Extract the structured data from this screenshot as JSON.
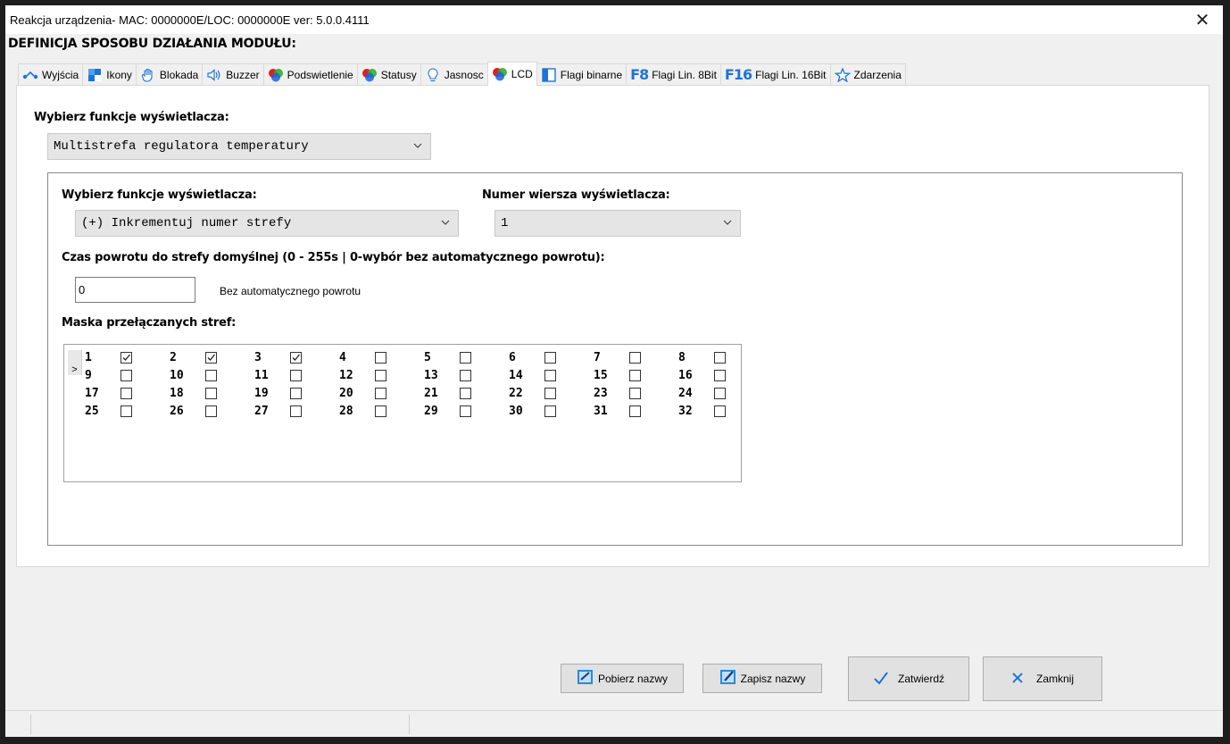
{
  "window": {
    "title": "Reakcja urządzenia- MAC: 0000000E/LOC: 0000000E ver: 5.0.0.4111",
    "close_glyph": "✕"
  },
  "header": {
    "title": "DEFINICJA SPOSOBU DZIAŁANIA MODUŁU:"
  },
  "tabs": [
    {
      "label": "Wyjścia",
      "icon": "outputs-icon"
    },
    {
      "label": "Ikony",
      "icon": "icons-icon"
    },
    {
      "label": "Blokada",
      "icon": "hand-icon"
    },
    {
      "label": "Buzzer",
      "icon": "speaker-icon"
    },
    {
      "label": "Podswietlenie",
      "icon": "rgb-icon"
    },
    {
      "label": "Statusy",
      "icon": "rgb-icon"
    },
    {
      "label": "Jasnosc",
      "icon": "bulb-icon"
    },
    {
      "label": "LCD",
      "icon": "rgb-icon",
      "active": true
    },
    {
      "label": "Flagi binarne",
      "icon": "binary-flag-icon"
    },
    {
      "label": "Flagi Lin. 8Bit",
      "icon": "f8-icon",
      "icon_text": "F8"
    },
    {
      "label": "Flagi Lin. 16Bit",
      "icon": "f16-icon",
      "icon_text": "F16"
    },
    {
      "label": "Zdarzenia",
      "icon": "star-icon"
    }
  ],
  "lcd": {
    "function_label": "Wybierz funkcje wyświetlacza:",
    "function_value": "Multistrefa regulatora temperatury",
    "group": {
      "sub_function_label": "Wybierz funkcje wyświetlacza:",
      "sub_function_value": "(+) Inkrementuj numer strefy",
      "row_label": "Numer wiersza wyświetlacza:",
      "row_value": "1",
      "return_time_label": "Czas powrotu do strefy domyślnej (0 - 255s | 0-wybór bez automatycznego powrotu):",
      "return_time_value": "0",
      "return_time_desc": "Bez automatycznego powrotu",
      "mask_label": "Maska przełączanych stref:",
      "row_marker": ">",
      "zones": [
        {
          "n": "1",
          "checked": true
        },
        {
          "n": "2",
          "checked": true
        },
        {
          "n": "3",
          "checked": true
        },
        {
          "n": "4",
          "checked": false
        },
        {
          "n": "5",
          "checked": false
        },
        {
          "n": "6",
          "checked": false
        },
        {
          "n": "7",
          "checked": false
        },
        {
          "n": "8",
          "checked": false
        },
        {
          "n": "9",
          "checked": false
        },
        {
          "n": "10",
          "checked": false
        },
        {
          "n": "11",
          "checked": false
        },
        {
          "n": "12",
          "checked": false
        },
        {
          "n": "13",
          "checked": false
        },
        {
          "n": "14",
          "checked": false
        },
        {
          "n": "15",
          "checked": false
        },
        {
          "n": "16",
          "checked": false
        },
        {
          "n": "17",
          "checked": false
        },
        {
          "n": "18",
          "checked": false
        },
        {
          "n": "19",
          "checked": false
        },
        {
          "n": "20",
          "checked": false
        },
        {
          "n": "21",
          "checked": false
        },
        {
          "n": "22",
          "checked": false
        },
        {
          "n": "23",
          "checked": false
        },
        {
          "n": "24",
          "checked": false
        },
        {
          "n": "25",
          "checked": false
        },
        {
          "n": "26",
          "checked": false
        },
        {
          "n": "27",
          "checked": false
        },
        {
          "n": "28",
          "checked": false
        },
        {
          "n": "29",
          "checked": false
        },
        {
          "n": "30",
          "checked": false
        },
        {
          "n": "31",
          "checked": false
        },
        {
          "n": "32",
          "checked": false
        }
      ]
    }
  },
  "buttons": {
    "get_names": "Pobierz nazwy",
    "save_names": "Zapisz nazwy",
    "confirm": "Zatwierdź",
    "close": "Zamknij"
  },
  "colors": {
    "accent_blue": "#1f73d8",
    "rgb_red": "#e02020",
    "rgb_green": "#2cb02c",
    "rgb_blue": "#2060e0"
  }
}
